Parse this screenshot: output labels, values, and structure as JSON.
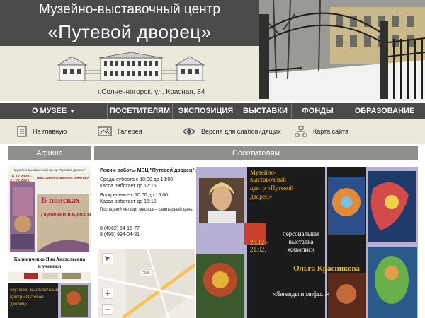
{
  "header": {
    "title_line1": "Музейно-выставочный центр",
    "title_line2": "«Путевой дворец»",
    "address": "г.Солнечногорск, ул. Красная, 84"
  },
  "nav": {
    "items": [
      {
        "label": "О МУЗЕЕ",
        "has_dropdown": true
      },
      {
        "label": "ПОСЕТИТЕЛЯМ"
      },
      {
        "label": "ЭКСПОЗИЦИЯ"
      },
      {
        "label": "ВЫСТАВКИ"
      },
      {
        "label": "ФОНДЫ"
      },
      {
        "label": "ОБРАЗОВАНИЕ"
      }
    ]
  },
  "subnav": {
    "home": "На главную",
    "gallery": "Галерея",
    "accessible": "Версия для слабовидящих",
    "sitemap": "Карта сайта"
  },
  "sections": {
    "afisha": "Афиша",
    "visitors": "Посетителям"
  },
  "poster1": {
    "org": "Музейно-выставочный центр \"Путевой дворец\"",
    "dates": "16.12.2020 -\n21.02.2021",
    "type": "ВЫСТАВКА ГОБЕЛЕНА И БАТИКА",
    "title_a": "В поисках",
    "title_b": "гармонии и красоты",
    "author": "Калиниченко Яна Анатольевна",
    "and_students": "и ученики"
  },
  "poster2": {
    "org_line1": "Музейно-выставочный",
    "org_line2": "центр «Путевой",
    "org_line3": "дворец»"
  },
  "info": {
    "heading": "Режим работы МВЦ \"Путевой дворец\":",
    "weekdays": "Среда-суббота с 10:00 до 18:00",
    "weekdays_cash": "Касса работает до 17:15",
    "sunday": "Воскресенье с 10:00 до 16:00",
    "sunday_cash": "Касса работает до 15:15",
    "sanitary": "Последний четверг месяца – санитарный день.",
    "phone1": "8 (4962) 64-15-77",
    "phone2": "8 (495) 994-04-81"
  },
  "map": {
    "road_label": "Е105",
    "zoom_in": "+",
    "zoom_out": "−"
  },
  "expo": {
    "org_line1": "Музейно-",
    "org_line2": "выставочный",
    "org_line3": "центр «Путевой",
    "org_line4": "дворец»",
    "dates_a": "25.12 -",
    "dates_b": "21.02.",
    "desc_line1": "персональная",
    "desc_line2": "выставка",
    "desc_line3": "живописи",
    "artist": "Ольга Красникова",
    "title": "«Легенды и мифы...»"
  },
  "colors": {
    "dark_bar": "#4a4a4a",
    "beige": "#ebe9dc",
    "section_gray": "#8e8e8a",
    "expo_lilac": "#b8b0d4",
    "gold_text": "#e5b23a"
  }
}
